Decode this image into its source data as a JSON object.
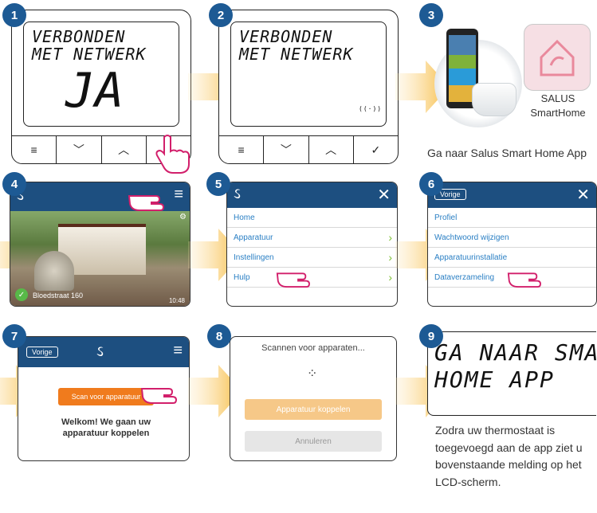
{
  "steps": [
    "1",
    "2",
    "3",
    "4",
    "5",
    "6",
    "7",
    "8",
    "9"
  ],
  "step1": {
    "line1": "VERBONDEN",
    "line2": "MET NETWERK",
    "big": "JA"
  },
  "step2": {
    "line1": "VERBONDEN",
    "line2": "MET NETWERK",
    "wifi": "((·))"
  },
  "buttons": {
    "menu": "≡",
    "down": "﹀",
    "up": "︿",
    "ok": "✓"
  },
  "step3": {
    "brand1": "SALUS",
    "brand2": "SmartHome",
    "caption": "Ga naar Salus Smart Home App"
  },
  "step4": {
    "address": "Bloedstraat 160",
    "time": "10:48"
  },
  "step5": {
    "items": [
      "Home",
      "Apparatuur",
      "Instellingen",
      "Hulp"
    ]
  },
  "step6": {
    "back": "Vorige",
    "items": [
      "Profiel",
      "Wachtwoord wijzigen",
      "Apparatuurinstallatie",
      "Dataverzameling"
    ]
  },
  "step7": {
    "back": "Vorige",
    "scan_button": "Scan voor apparatuur",
    "welcome": "Welkom! We gaan uw apparatuur koppelen"
  },
  "step8": {
    "title": "Scannen voor apparaten...",
    "pair": "Apparatuur koppelen",
    "cancel": "Annuleren"
  },
  "step9": {
    "line1": "GA NAAR SMAR",
    "line2": "HOME APP",
    "caption": "Zodra uw thermostaat is toegevoegd aan de app ziet u bovenstaande melding op het LCD-scherm."
  },
  "colors": {
    "badge": "#1d5a94",
    "arrow": "#f7c04a",
    "header": "#1d4f80",
    "orange": "#f07b1d"
  }
}
